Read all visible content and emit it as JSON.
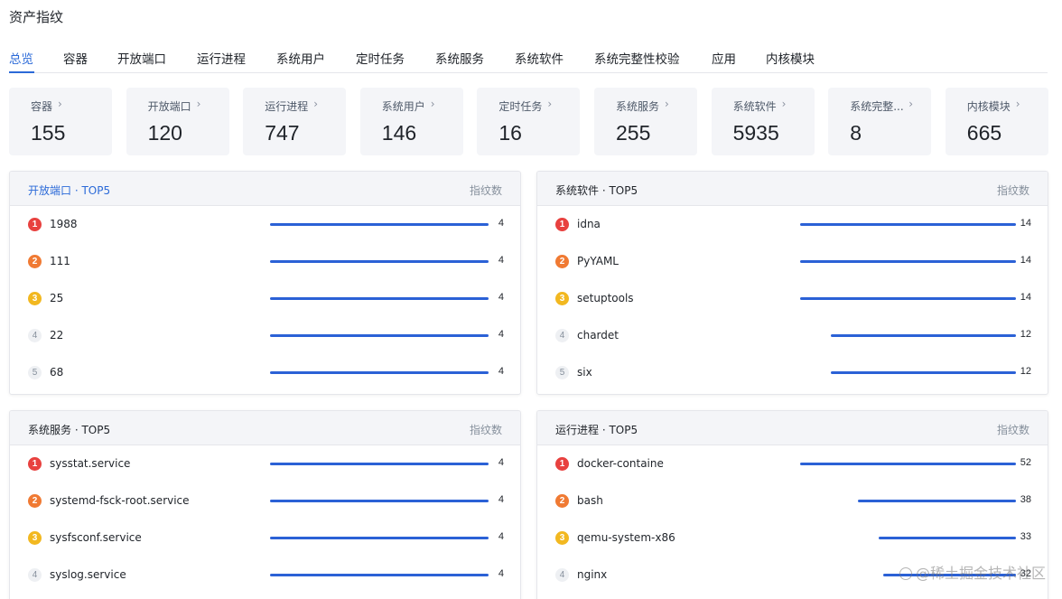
{
  "page": {
    "title": "资产指纹"
  },
  "tabs": [
    {
      "label": "总览",
      "active": true
    },
    {
      "label": "容器"
    },
    {
      "label": "开放端口"
    },
    {
      "label": "运行进程"
    },
    {
      "label": "系统用户"
    },
    {
      "label": "定时任务"
    },
    {
      "label": "系统服务"
    },
    {
      "label": "系统软件"
    },
    {
      "label": "系统完整性校验"
    },
    {
      "label": "应用"
    },
    {
      "label": "内核模块"
    }
  ],
  "stats": [
    {
      "label": "容器",
      "value": "155"
    },
    {
      "label": "开放端口",
      "value": "120"
    },
    {
      "label": "运行进程",
      "value": "747"
    },
    {
      "label": "系统用户",
      "value": "146"
    },
    {
      "label": "定时任务",
      "value": "16"
    },
    {
      "label": "系统服务",
      "value": "255"
    },
    {
      "label": "系统软件",
      "value": "5935"
    },
    {
      "label": "系统完整...",
      "value": "8"
    },
    {
      "label": "内核模块",
      "value": "665"
    }
  ],
  "panels": [
    {
      "title": "开放端口 · TOP5",
      "metric": "指纹数",
      "max": 4,
      "rows": [
        {
          "rank": "1",
          "name": "1988",
          "value": 4
        },
        {
          "rank": "2",
          "name": "111",
          "value": 4
        },
        {
          "rank": "3",
          "name": "25",
          "value": 4
        },
        {
          "rank": "4",
          "name": "22",
          "value": 4
        },
        {
          "rank": "5",
          "name": "68",
          "value": 4
        }
      ]
    },
    {
      "title": "系统软件 · TOP5",
      "metric": "指纹数",
      "max": 14,
      "rows": [
        {
          "rank": "1",
          "name": "idna",
          "value": 14
        },
        {
          "rank": "2",
          "name": "PyYAML",
          "value": 14
        },
        {
          "rank": "3",
          "name": "setuptools",
          "value": 14
        },
        {
          "rank": "4",
          "name": "chardet",
          "value": 12
        },
        {
          "rank": "5",
          "name": "six",
          "value": 12
        }
      ]
    },
    {
      "title": "系统服务 · TOP5",
      "metric": "指纹数",
      "max": 4,
      "rows": [
        {
          "rank": "1",
          "name": "sysstat.service",
          "value": 4
        },
        {
          "rank": "2",
          "name": "systemd-fsck-root.service",
          "value": 4
        },
        {
          "rank": "3",
          "name": "sysfsconf.service",
          "value": 4
        },
        {
          "rank": "4",
          "name": "syslog.service",
          "value": 4
        }
      ]
    },
    {
      "title": "运行进程 · TOP5",
      "metric": "指纹数",
      "max": 52,
      "rows": [
        {
          "rank": "1",
          "name": "docker-containe",
          "value": 52
        },
        {
          "rank": "2",
          "name": "bash",
          "value": 38
        },
        {
          "rank": "3",
          "name": "qemu-system-x86",
          "value": 33
        },
        {
          "rank": "4",
          "name": "nginx",
          "value": 32
        }
      ]
    }
  ],
  "watermark": "@稀土掘金技术社区",
  "colors": {
    "accent": "#2b6ad8",
    "bar": "#2b61d6",
    "rank1": "#e8413f",
    "rank2": "#f07a33",
    "rank3": "#f2b820"
  }
}
